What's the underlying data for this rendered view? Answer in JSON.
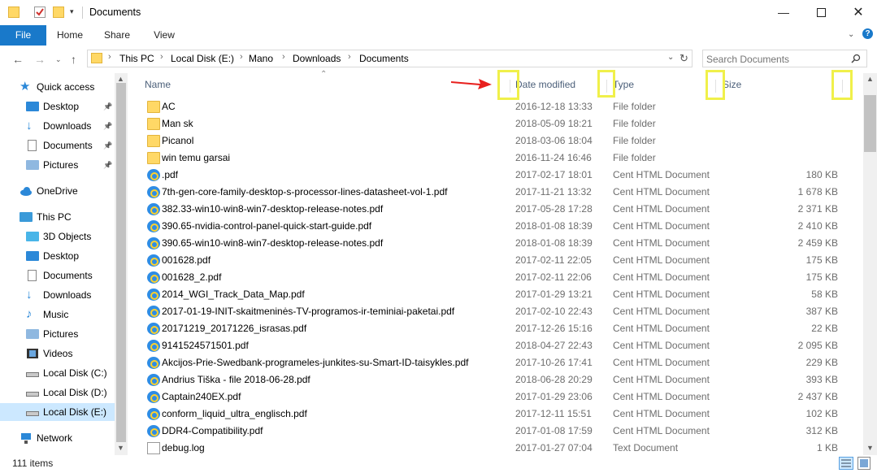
{
  "window": {
    "title": "Documents"
  },
  "ribbon": {
    "tabs": [
      "File",
      "Home",
      "Share",
      "View"
    ]
  },
  "address": {
    "crumbs": [
      "This PC",
      "Local Disk (E:)",
      "Mano",
      "Downloads",
      "Documents"
    ],
    "search_placeholder": "Search Documents"
  },
  "nav": {
    "items": [
      {
        "label": "Quick access",
        "icon": "star-icon"
      },
      {
        "label": "Desktop",
        "icon": "desktop-icon",
        "pinned": true
      },
      {
        "label": "Downloads",
        "icon": "download-arrow-icon",
        "pinned": true
      },
      {
        "label": "Documents",
        "icon": "document-icon",
        "pinned": true
      },
      {
        "label": "Pictures",
        "icon": "pictures-icon",
        "pinned": true
      },
      {
        "label": "OneDrive",
        "icon": "cloud-icon"
      },
      {
        "label": "This PC",
        "icon": "computer-icon"
      },
      {
        "label": "3D Objects",
        "icon": "cube-icon"
      },
      {
        "label": "Desktop",
        "icon": "desktop-icon"
      },
      {
        "label": "Documents",
        "icon": "document-icon"
      },
      {
        "label": "Downloads",
        "icon": "download-arrow-icon"
      },
      {
        "label": "Music",
        "icon": "music-icon"
      },
      {
        "label": "Pictures",
        "icon": "pictures-icon"
      },
      {
        "label": "Videos",
        "icon": "video-icon"
      },
      {
        "label": "Local Disk (C:)",
        "icon": "drive-icon"
      },
      {
        "label": "Local Disk (D:)",
        "icon": "drive-icon"
      },
      {
        "label": "Local Disk (E:)",
        "icon": "drive-icon",
        "selected": true
      },
      {
        "label": "Network",
        "icon": "network-icon"
      }
    ]
  },
  "columns": {
    "name": "Name",
    "date": "Date modified",
    "type": "Type",
    "size": "Size"
  },
  "files": [
    {
      "name": "AC",
      "date": "2016-12-18 13:33",
      "type": "File folder",
      "size": "",
      "kind": "folder"
    },
    {
      "name": "Man sk",
      "date": "2018-05-09 18:21",
      "type": "File folder",
      "size": "",
      "kind": "folder"
    },
    {
      "name": "Picanol",
      "date": "2018-03-06 18:04",
      "type": "File folder",
      "size": "",
      "kind": "folder"
    },
    {
      "name": "win temu garsai",
      "date": "2016-11-24 16:46",
      "type": "File folder",
      "size": "",
      "kind": "folder"
    },
    {
      "name": ".pdf",
      "date": "2017-02-17 18:01",
      "type": "Cent HTML Document",
      "size": "180 KB",
      "kind": "pdf"
    },
    {
      "name": "7th-gen-core-family-desktop-s-processor-lines-datasheet-vol-1.pdf",
      "date": "2017-11-21 13:32",
      "type": "Cent HTML Document",
      "size": "1 678 KB",
      "kind": "pdf"
    },
    {
      "name": "382.33-win10-win8-win7-desktop-release-notes.pdf",
      "date": "2017-05-28 17:28",
      "type": "Cent HTML Document",
      "size": "2 371 KB",
      "kind": "pdf"
    },
    {
      "name": "390.65-nvidia-control-panel-quick-start-guide.pdf",
      "date": "2018-01-08 18:39",
      "type": "Cent HTML Document",
      "size": "2 410 KB",
      "kind": "pdf"
    },
    {
      "name": "390.65-win10-win8-win7-desktop-release-notes.pdf",
      "date": "2018-01-08 18:39",
      "type": "Cent HTML Document",
      "size": "2 459 KB",
      "kind": "pdf"
    },
    {
      "name": "001628.pdf",
      "date": "2017-02-11 22:05",
      "type": "Cent HTML Document",
      "size": "175 KB",
      "kind": "pdf"
    },
    {
      "name": "001628_2.pdf",
      "date": "2017-02-11 22:06",
      "type": "Cent HTML Document",
      "size": "175 KB",
      "kind": "pdf"
    },
    {
      "name": "2014_WGI_Track_Data_Map.pdf",
      "date": "2017-01-29 13:21",
      "type": "Cent HTML Document",
      "size": "58 KB",
      "kind": "pdf"
    },
    {
      "name": "2017-01-19-INIT-skaitmeninės-TV-programos-ir-teminiai-paketai.pdf",
      "date": "2017-02-10 22:43",
      "type": "Cent HTML Document",
      "size": "387 KB",
      "kind": "pdf"
    },
    {
      "name": "20171219_20171226_israsas.pdf",
      "date": "2017-12-26 15:16",
      "type": "Cent HTML Document",
      "size": "22 KB",
      "kind": "pdf"
    },
    {
      "name": "9141524571501.pdf",
      "date": "2018-04-27 22:43",
      "type": "Cent HTML Document",
      "size": "2 095 KB",
      "kind": "pdf"
    },
    {
      "name": "Akcijos-Prie-Swedbank-programeles-junkites-su-Smart-ID-taisykles.pdf",
      "date": "2017-10-26 17:41",
      "type": "Cent HTML Document",
      "size": "229 KB",
      "kind": "pdf"
    },
    {
      "name": "Andrius Tiška - file 2018-06-28.pdf",
      "date": "2018-06-28 20:29",
      "type": "Cent HTML Document",
      "size": "393 KB",
      "kind": "pdf"
    },
    {
      "name": "Captain240EX.pdf",
      "date": "2017-01-29 23:06",
      "type": "Cent HTML Document",
      "size": "2 437 KB",
      "kind": "pdf"
    },
    {
      "name": "conform_liquid_ultra_englisch.pdf",
      "date": "2017-12-11 15:51",
      "type": "Cent HTML Document",
      "size": "102 KB",
      "kind": "pdf"
    },
    {
      "name": "DDR4-Compatibility.pdf",
      "date": "2017-01-08 17:59",
      "type": "Cent HTML Document",
      "size": "312 KB",
      "kind": "pdf"
    },
    {
      "name": "debug.log",
      "date": "2017-01-27 07:04",
      "type": "Text Document",
      "size": "1 KB",
      "kind": "txt"
    }
  ],
  "status": {
    "item_count": "111 items"
  }
}
